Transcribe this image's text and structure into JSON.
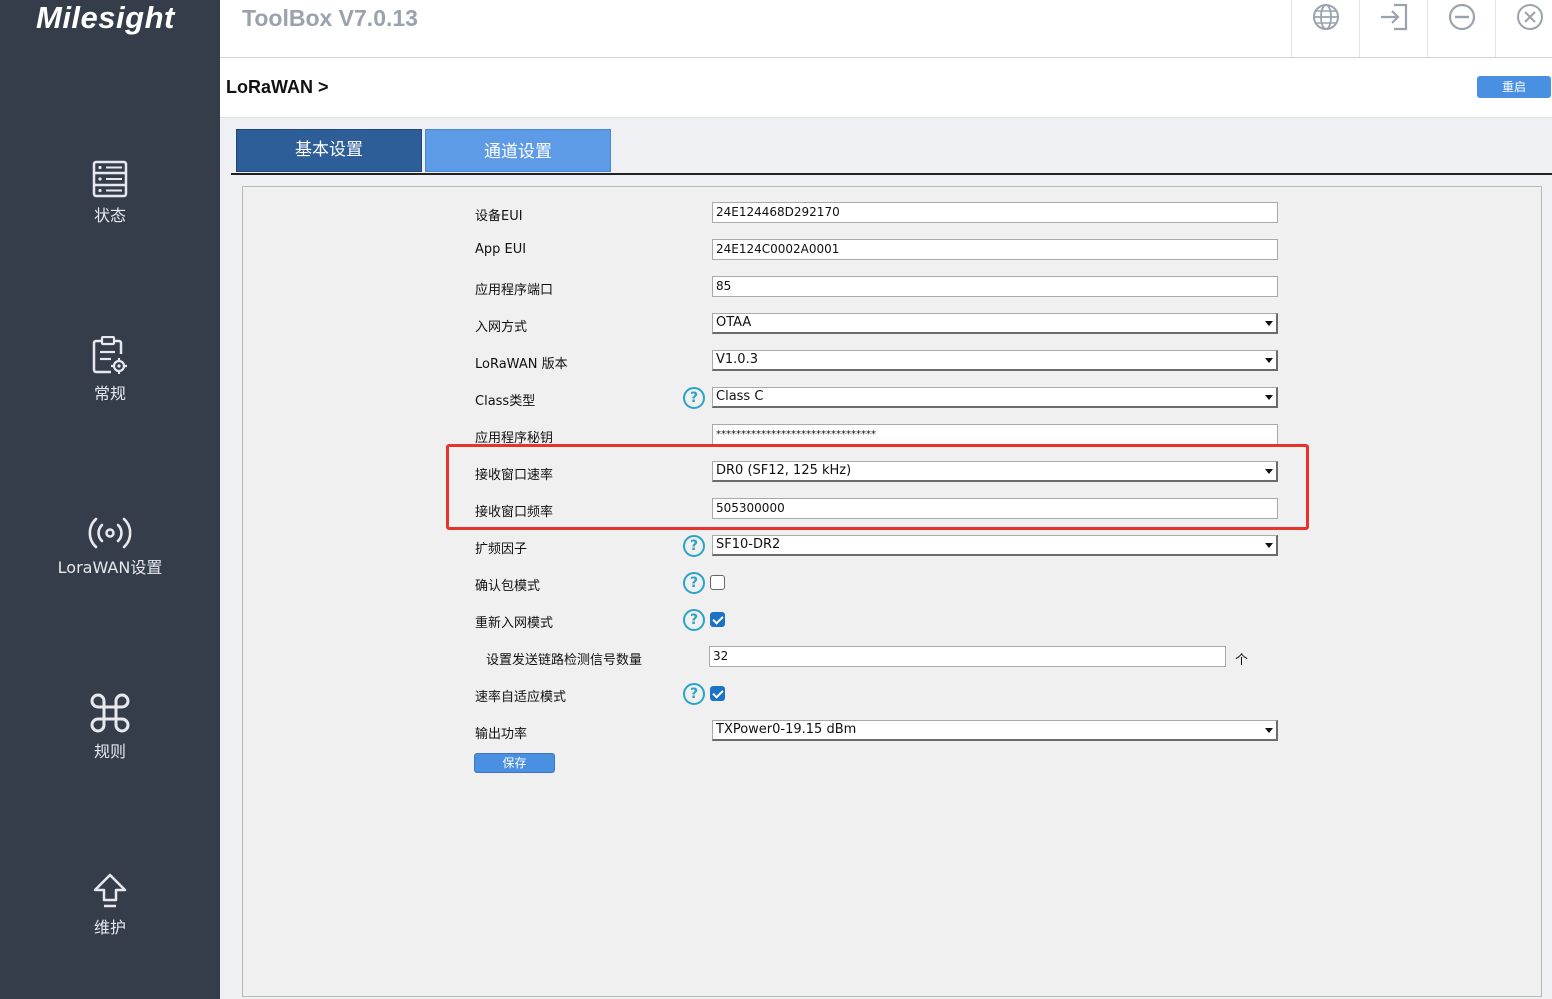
{
  "app": {
    "logo": "Milesight",
    "title": "ToolBox V7.0.13"
  },
  "header": {
    "icons": [
      "globe-icon",
      "logout-icon",
      "minimize-icon",
      "close-icon"
    ]
  },
  "sidebar": {
    "items": [
      {
        "label": "状态",
        "icon": "server-status-icon"
      },
      {
        "label": "常规",
        "icon": "settings-clipboard-icon"
      },
      {
        "label": "LoraWAN设置",
        "icon": "wireless-signal-icon"
      },
      {
        "label": "规则",
        "icon": "command-icon"
      },
      {
        "label": "维护",
        "icon": "upload-arrow-icon"
      }
    ]
  },
  "breadcrumb": "LoRaWAN >",
  "restart_label": "重启",
  "tabs": [
    {
      "label": "基本设置",
      "active": true
    },
    {
      "label": "通道设置",
      "active": false
    }
  ],
  "form": {
    "device_eui": {
      "label": "设备EUI",
      "value": "24E124468D292170"
    },
    "app_eui": {
      "label": "App EUI",
      "value": "24E124C0002A0001"
    },
    "app_port": {
      "label": "应用程序端口",
      "value": "85"
    },
    "join_type": {
      "label": "入网方式",
      "value": "OTAA"
    },
    "lorawan_version": {
      "label": "LoRaWAN 版本",
      "value": "V1.0.3"
    },
    "class_type": {
      "label": "Class类型",
      "value": "Class C"
    },
    "app_key": {
      "label": "应用程序秘钥",
      "value": "********************************"
    },
    "rx2_datarate": {
      "label": "接收窗口速率",
      "value": "DR0 (SF12, 125 kHz)"
    },
    "rx2_frequency": {
      "label": "接收窗口频率",
      "value": "505300000"
    },
    "spread_factor": {
      "label": "扩频因子",
      "value": "SF10-DR2"
    },
    "confirmed_mode": {
      "label": "确认包模式",
      "checked": false
    },
    "rejoin_mode": {
      "label": "重新入网模式",
      "checked": true
    },
    "link_check_count": {
      "label": "设置发送链路检测信号数量",
      "value": "32",
      "unit": "个"
    },
    "adr_mode": {
      "label": "速率自适应模式",
      "checked": true
    },
    "tx_power": {
      "label": "输出功率",
      "value": "TXPower0-19.15 dBm"
    },
    "help_symbol": "?",
    "save_label": "保存"
  },
  "colors": {
    "sidebar_bg": "#353c4a",
    "tab_active": "#2d5e98",
    "tab_inactive": "#5d9be6",
    "button": "#4a90e2",
    "highlight": "#e8332c",
    "help": "#29a3c7"
  }
}
